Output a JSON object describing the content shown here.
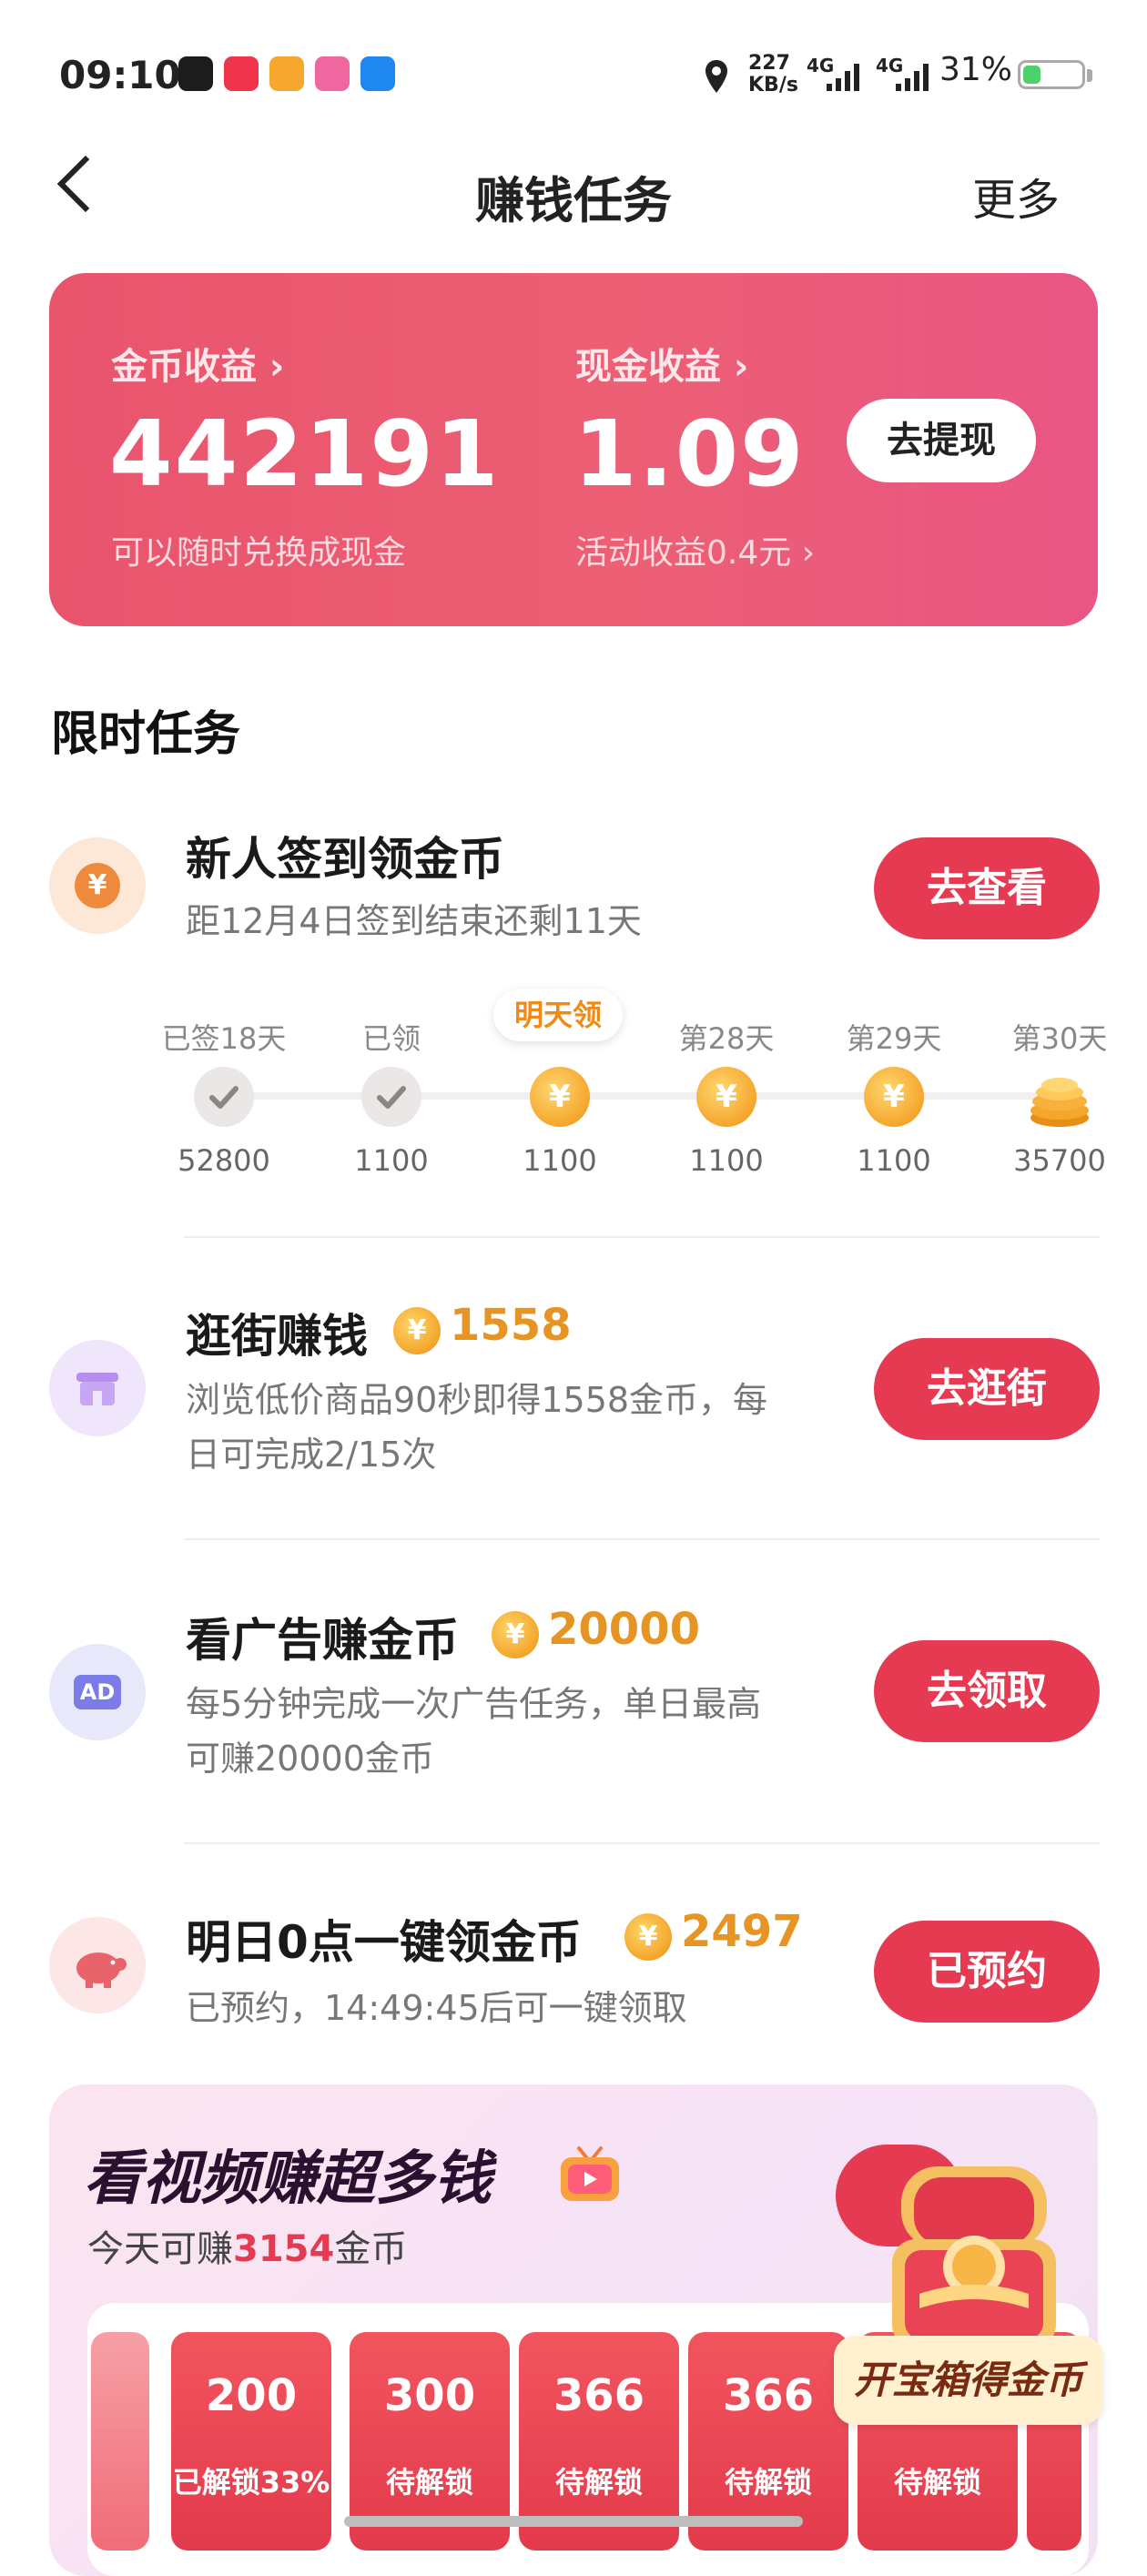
{
  "status_bar": {
    "time": "09:10",
    "net_speed": "227",
    "net_unit": "KB/s",
    "signal1": "4G",
    "signal2": "4G",
    "battery": "31%",
    "battery_level": 0.31
  },
  "nav": {
    "title": "赚钱任务",
    "more": "更多"
  },
  "earnings": {
    "coin_label": "金币收益 ›",
    "coin_value": "442191",
    "coin_sub": "可以随时兑换成现金",
    "cash_label": "现金收益 ›",
    "cash_value": "1.09",
    "cash_sub": "活动收益0.4元 ›",
    "withdraw": "去提现"
  },
  "section_title": "限时任务",
  "checkin": {
    "title": "新人签到领金币",
    "desc": "距12月4日签到结束还剩11天",
    "button": "去查看",
    "tomorrow_tag": "明天领",
    "days": [
      {
        "label": "已签18天",
        "amount": "52800",
        "state": "done"
      },
      {
        "label": "已领",
        "amount": "1100",
        "state": "done"
      },
      {
        "label": "",
        "amount": "1100",
        "state": "tomorrow"
      },
      {
        "label": "第28天",
        "amount": "1100",
        "state": "coin"
      },
      {
        "label": "第29天",
        "amount": "1100",
        "state": "coin"
      },
      {
        "label": "第30天",
        "amount": "35700",
        "state": "stack"
      }
    ]
  },
  "tasks": [
    {
      "title": "逛街赚钱",
      "reward": "1558",
      "desc1": "浏览低价商品90秒即得1558金币，每",
      "desc2": "日可完成2/15次",
      "button": "去逛街"
    },
    {
      "title": "看广告赚金币",
      "reward": "20000",
      "desc1": "每5分钟完成一次广告任务，单日最高",
      "desc2": "可赚20000金币",
      "button": "去领取",
      "icon_text": "AD"
    },
    {
      "title": "明日0点一键领金币",
      "reward": "2497",
      "desc1": "已预约，14:49:45后可一键领取",
      "desc2": "",
      "button": "已预约"
    }
  ],
  "video": {
    "title": "看视频赚超多钱",
    "sub_prefix": "今天可赚",
    "sub_amount": "3154",
    "sub_suffix": "金币",
    "treasure_label": "开宝箱得金币",
    "tiles": [
      {
        "value": "200",
        "status": "已解锁33%"
      },
      {
        "value": "300",
        "status": "待解锁"
      },
      {
        "value": "366",
        "status": "待解锁"
      },
      {
        "value": "366",
        "status": "待解锁"
      },
      {
        "value": "",
        "status": "待解锁"
      }
    ]
  },
  "colors": {
    "accent": "#e63a53",
    "card": "#eb5a72",
    "coin": "#f5a62c"
  }
}
